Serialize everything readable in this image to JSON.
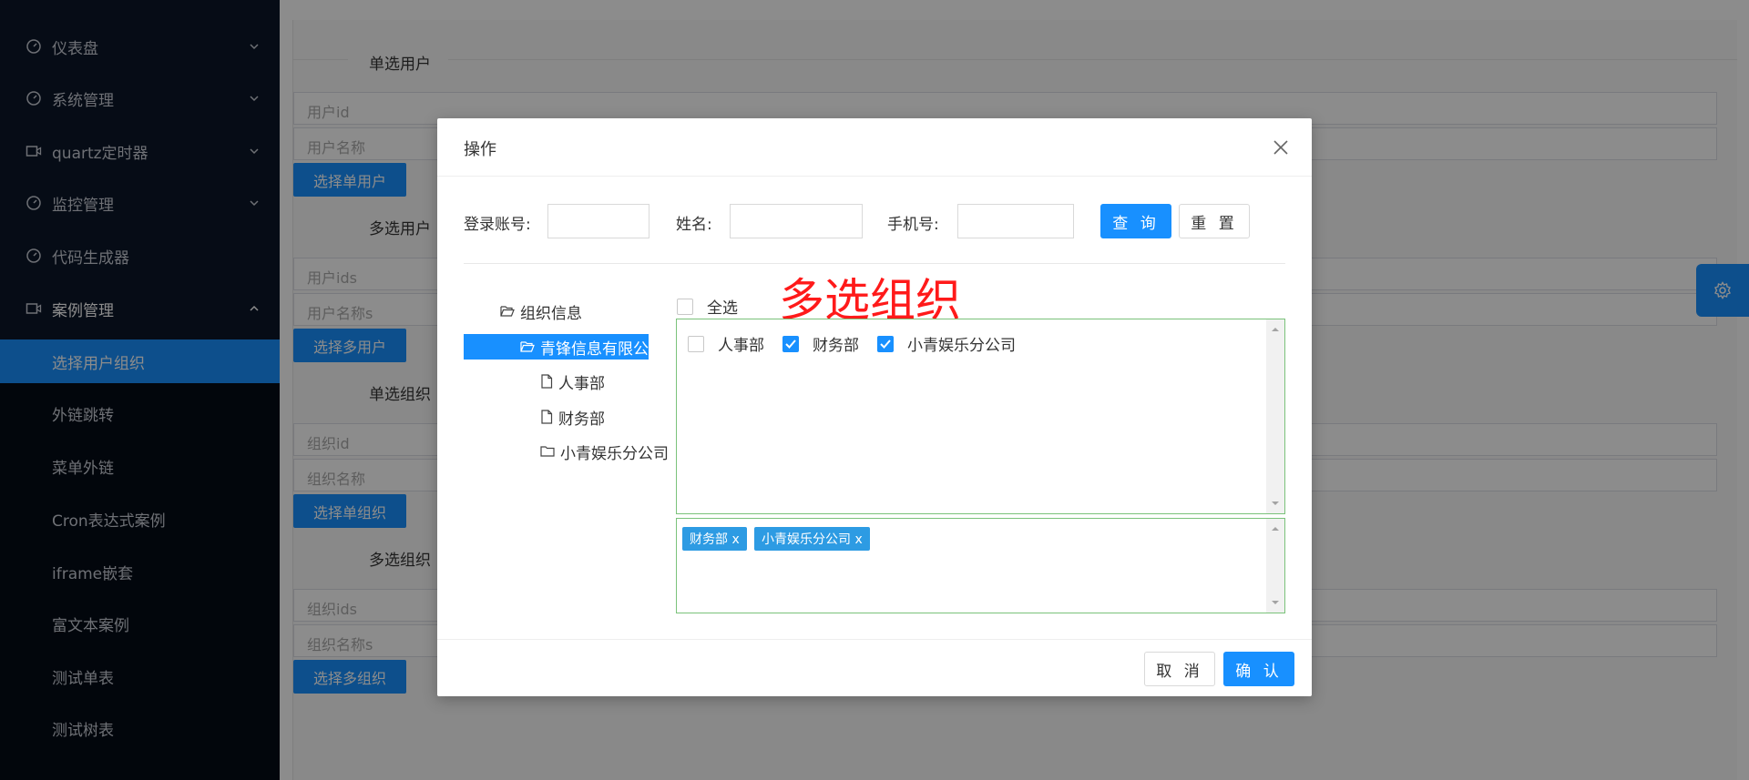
{
  "sidebar": {
    "menu": [
      {
        "label": "仪表盘",
        "icon": "dashboard-icon",
        "expandable": true
      },
      {
        "label": "系统管理",
        "icon": "dashboard-icon",
        "expandable": true
      },
      {
        "label": "quartz定时器",
        "icon": "video-icon",
        "expandable": true
      },
      {
        "label": "监控管理",
        "icon": "dashboard-icon",
        "expandable": true
      },
      {
        "label": "代码生成器",
        "icon": "dashboard-icon",
        "expandable": false
      },
      {
        "label": "案例管理",
        "icon": "video-icon",
        "expandable": true,
        "expanded": true
      }
    ],
    "submenu": [
      {
        "label": "选择用户组织",
        "active": true
      },
      {
        "label": "外链跳转"
      },
      {
        "label": "菜单外链"
      },
      {
        "label": "Cron表达式案例"
      },
      {
        "label": "iframe嵌套"
      },
      {
        "label": "富文本案例"
      },
      {
        "label": "测试单表"
      },
      {
        "label": "测试树表"
      }
    ]
  },
  "page": {
    "sections": [
      {
        "title": "单选用户",
        "fields": [
          "用户id",
          "用户名称"
        ],
        "button": "选择单用户"
      },
      {
        "title": "多选用户",
        "fields": [
          "用户ids",
          "用户名称s"
        ],
        "button": "选择多用户"
      },
      {
        "title": "单选组织",
        "fields": [
          "组织id",
          "组织名称"
        ],
        "button": "选择单组织"
      },
      {
        "title": "多选组织",
        "fields": [
          "组织ids",
          "组织名称s"
        ],
        "button": "选择多组织"
      }
    ]
  },
  "modal": {
    "title": "操作",
    "query": {
      "login_label": "登录账号:",
      "name_label": "姓名:",
      "phone_label": "手机号:",
      "search_button": "查 询",
      "reset_button": "重 置"
    },
    "tree": {
      "root": "组织信息",
      "company": "青锋信息有限公",
      "children": [
        "人事部",
        "财务部",
        "小青娱乐分公司"
      ]
    },
    "annotation": "多选组织",
    "select_all": "全选",
    "options": [
      {
        "label": "人事部",
        "checked": false
      },
      {
        "label": "财务部",
        "checked": true
      },
      {
        "label": "小青娱乐分公司",
        "checked": true
      }
    ],
    "selected_tags": [
      "财务部 x",
      "小青娱乐分公司 x"
    ],
    "cancel_button": "取 消",
    "confirm_button": "确 认"
  },
  "colors": {
    "sidebar_bg": "#0b1628",
    "accent": "#1890ff",
    "annotation": "#ff1a1a",
    "tag_bg": "#2d9be3",
    "box_border": "#7ac27a"
  }
}
